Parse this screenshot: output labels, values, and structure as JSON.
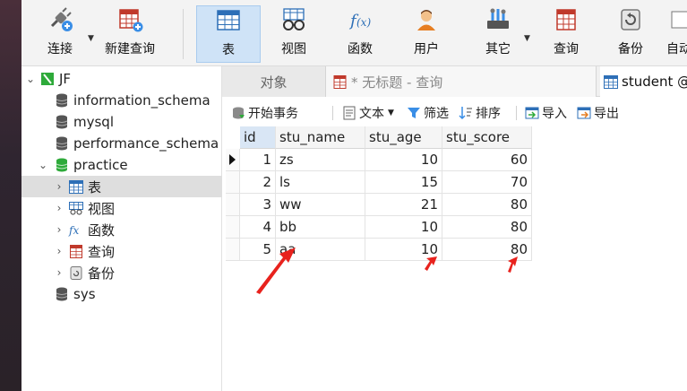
{
  "toolbar": {
    "items": [
      {
        "label": "连接",
        "icon": "plug-connect-icon"
      },
      {
        "label": "新建查询",
        "icon": "new-query-icon"
      },
      {
        "label": "表",
        "icon": "table-icon"
      },
      {
        "label": "视图",
        "icon": "view-glasses-icon"
      },
      {
        "label": "函数",
        "icon": "function-fx-icon"
      },
      {
        "label": "用户",
        "icon": "user-icon"
      },
      {
        "label": "其它",
        "icon": "tools-icon"
      },
      {
        "label": "查询",
        "icon": "query-icon"
      },
      {
        "label": "备份",
        "icon": "backup-icon"
      },
      {
        "label": "自动",
        "icon": "automation-icon"
      }
    ],
    "active": "表"
  },
  "sidebar": {
    "connection": "JF",
    "databases": [
      "information_schema",
      "mysql",
      "performance_schema",
      "practice",
      "sys"
    ],
    "practice_children": [
      "表",
      "视图",
      "函数",
      "查询",
      "备份"
    ],
    "selected": "表"
  },
  "tabs": {
    "objects": "对象",
    "query": "* 无标题 - 查询",
    "student": "student @pra"
  },
  "table_toolbar": {
    "begin_transaction": "开始事务",
    "text": "文本",
    "filter": "筛选",
    "sort": "排序",
    "import": "导入",
    "export": "导出"
  },
  "grid": {
    "columns": [
      "id",
      "stu_name",
      "stu_age",
      "stu_score"
    ],
    "rows": [
      [
        "1",
        "zs",
        "10",
        "60"
      ],
      [
        "2",
        "ls",
        "15",
        "70"
      ],
      [
        "3",
        "ww",
        "21",
        "80"
      ],
      [
        "4",
        "bb",
        "10",
        "80"
      ],
      [
        "5",
        "aa",
        "10",
        "80"
      ]
    ]
  },
  "colors": {
    "active_tab_bg": "#cfe3f7",
    "annotation_arrow": "#e8221d",
    "db_icon": "#555555",
    "db_active_icon": "#2eaa3a"
  }
}
